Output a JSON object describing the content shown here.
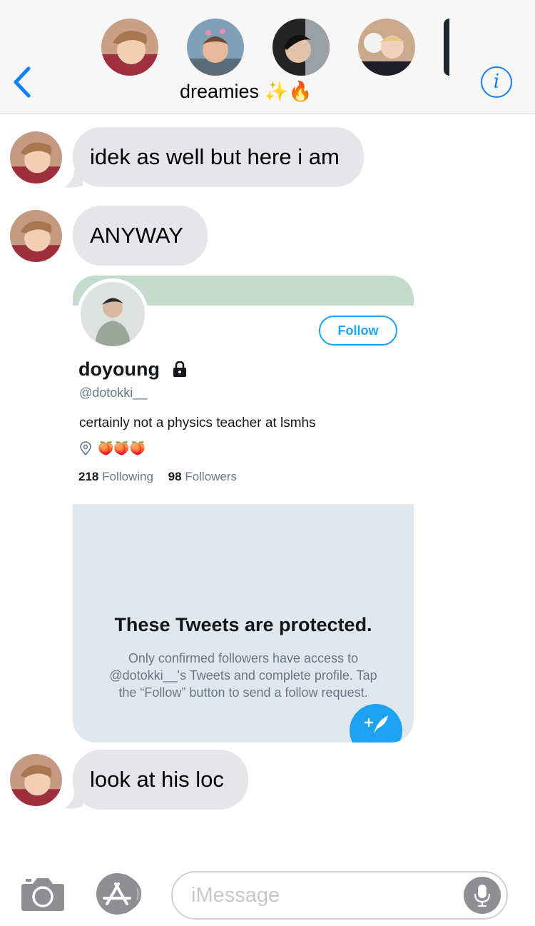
{
  "header": {
    "group_name": "dreamies",
    "group_emoji": "✨🔥",
    "back_icon": "chevron-left-icon",
    "info_icon": "info-icon",
    "info_glyph": "i"
  },
  "messages": [
    {
      "text": "idek as well but here i am"
    },
    {
      "text": "ANYWAY"
    },
    {
      "text": "look at his loc"
    }
  ],
  "shared_screenshot": {
    "follow_label": "Follow",
    "display_name": "doyoung",
    "handle": "@dotokki__",
    "bio": "certainly not a physics teacher at lsmhs",
    "location_emoji": "🍑🍑🍑",
    "following_count": "218",
    "following_label": "Following",
    "followers_count": "98",
    "followers_label": "Followers",
    "protected_title": "These Tweets are protected.",
    "protected_body": "Only confirmed followers have access to @dotokki__'s Tweets and complete profile. Tap the “Follow” button to send a follow request."
  },
  "composer": {
    "placeholder": "iMessage"
  },
  "colors": {
    "ios_blue": "#147efb",
    "bubble_gray": "#e5e5ea",
    "twitter_blue": "#1da1f2"
  }
}
